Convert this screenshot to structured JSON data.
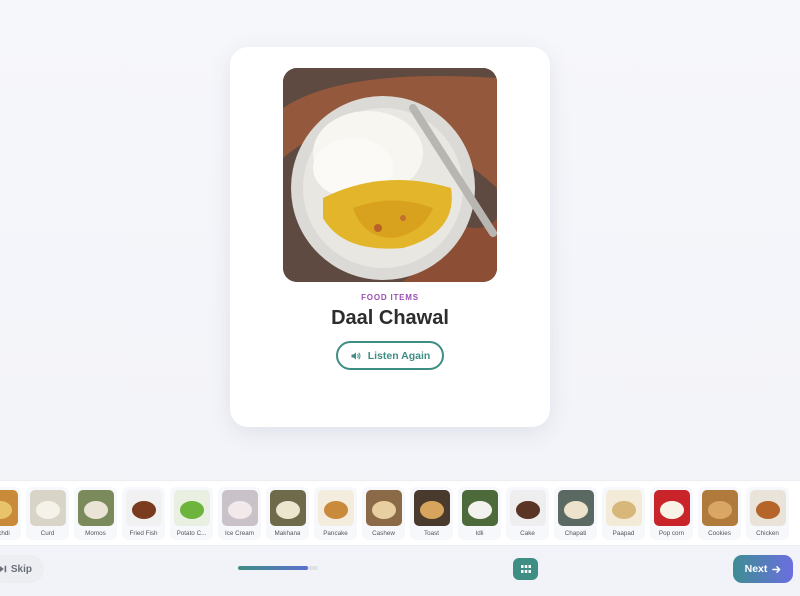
{
  "card": {
    "category": "FOOD ITEMS",
    "title": "Daal Chawal",
    "listen_label": "Listen Again"
  },
  "thumbnails": [
    {
      "label": "Khichdi",
      "color": "#c98b3a",
      "accent": "#e8c36a"
    },
    {
      "label": "Curd",
      "color": "#d9d4c8",
      "accent": "#f5f2ea"
    },
    {
      "label": "Momos",
      "color": "#7b8a5a",
      "accent": "#e9e4d6"
    },
    {
      "label": "Fried Fish",
      "color": "#f1f1f1",
      "accent": "#7a3b1e"
    },
    {
      "label": "Potato C...",
      "color": "#e9f0e2",
      "accent": "#6cb43c"
    },
    {
      "label": "Ice Cream",
      "color": "#c9c2c8",
      "accent": "#f3e9ea"
    },
    {
      "label": "Makhana",
      "color": "#6f6a4a",
      "accent": "#ede6cf"
    },
    {
      "label": "Pancake",
      "color": "#f4ecdc",
      "accent": "#c98a3c"
    },
    {
      "label": "Cashew",
      "color": "#8b6a48",
      "accent": "#e7cfa2"
    },
    {
      "label": "Toast",
      "color": "#4a3a2e",
      "accent": "#d6a45c"
    },
    {
      "label": "Idli",
      "color": "#4c6a3a",
      "accent": "#f2f2ee"
    },
    {
      "label": "Cake",
      "color": "#eeeeee",
      "accent": "#5a3424"
    },
    {
      "label": "Chapati",
      "color": "#5a6a62",
      "accent": "#ede2cc"
    },
    {
      "label": "Paapad",
      "color": "#f3ebd8",
      "accent": "#d8b87a"
    },
    {
      "label": "Pop corn",
      "color": "#c8242a",
      "accent": "#f8f3e6"
    },
    {
      "label": "Cookies",
      "color": "#b07a3c",
      "accent": "#d9a663"
    },
    {
      "label": "Chicken",
      "color": "#e9e3da",
      "accent": "#b5652a"
    }
  ],
  "footer": {
    "skip_label": "Skip",
    "next_label": "Next",
    "progress": 0.88
  },
  "colors": {
    "accent": "#3e8e83",
    "category": "#9b4fb3"
  },
  "icons": {
    "listen": "speaker-icon",
    "skip": "skip-icon",
    "grid": "grid-icon",
    "next": "arrow-right-icon"
  }
}
